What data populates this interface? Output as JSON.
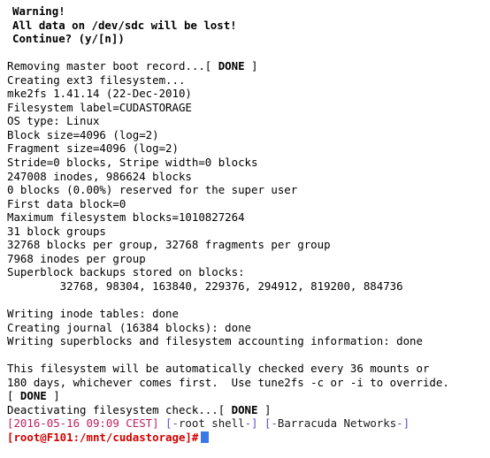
{
  "terminal": {
    "window_title": "mke2fs terminal output",
    "background_color": "#ffffff",
    "foreground_color": "#000000",
    "warning_block": [
      "Warning!",
      "All data on /dev/sdc will be lost!",
      "Continue? (y/[n])"
    ],
    "lines": [
      {
        "id": "removing-mbr",
        "pre": "Removing master boot record...[ ",
        "bold": "DONE",
        "post": " ]"
      },
      {
        "id": "creating-ext3",
        "text": "Creating ext3 filesystem..."
      },
      {
        "id": "mke2fs-version",
        "text": "mke2fs 1.41.14 (22-Dec-2010)"
      },
      {
        "id": "fs-label",
        "text": "Filesystem label=CUDASTORAGE"
      },
      {
        "id": "os-type",
        "text": "OS type: Linux"
      },
      {
        "id": "block-size",
        "text": "Block size=4096 (log=2)"
      },
      {
        "id": "fragment-size",
        "text": "Fragment size=4096 (log=2)"
      },
      {
        "id": "stride-stripe",
        "text": "Stride=0 blocks, Stripe width=0 blocks"
      },
      {
        "id": "inodes-blocks",
        "text": "247008 inodes, 986624 blocks"
      },
      {
        "id": "reserved-blocks",
        "text": "0 blocks (0.00%) reserved for the super user"
      },
      {
        "id": "first-data-block",
        "text": "First data block=0"
      },
      {
        "id": "max-fs-blocks",
        "text": "Maximum filesystem blocks=1010827264"
      },
      {
        "id": "block-groups",
        "text": "31 block groups"
      },
      {
        "id": "blocks-per-group",
        "text": "32768 blocks per group, 32768 fragments per group"
      },
      {
        "id": "inodes-per-group",
        "text": "7968 inodes per group"
      },
      {
        "id": "superblock-header",
        "text": "Superblock backups stored on blocks:"
      },
      {
        "id": "superblock-list",
        "text": "        32768, 98304, 163840, 229376, 294912, 819200, 884736"
      },
      {
        "id": "blank-1",
        "text": ""
      },
      {
        "id": "writing-inode-tables",
        "text": "Writing inode tables: done"
      },
      {
        "id": "creating-journal",
        "text": "Creating journal (16384 blocks): done"
      },
      {
        "id": "writing-superblocks",
        "text": "Writing superblocks and filesystem accounting information: done"
      },
      {
        "id": "blank-2",
        "text": ""
      },
      {
        "id": "autocheck-1",
        "text": "This filesystem will be automatically checked every 36 mounts or"
      },
      {
        "id": "autocheck-2",
        "text": "180 days, whichever comes first.  Use tune2fs -c or -i to override."
      },
      {
        "id": "done-standalone",
        "pre": "[ ",
        "bold": "DONE",
        "post": " ]"
      },
      {
        "id": "deactivating-check",
        "pre": "Deactivating filesystem check...[ ",
        "bold": "DONE",
        "post": " ]"
      }
    ],
    "status_line": {
      "timestamp": "[2016-05-16 09:09 CEST]",
      "shell_open": " [-",
      "shell_label": "root shell",
      "shell_close": "-] ",
      "vendor_open": "[-",
      "vendor_label": "Barracuda Networks",
      "vendor_close": "-]",
      "color": "#c02060",
      "bracket_color": "#5a4fcf"
    },
    "prompt_line": {
      "text": "[root@F101:/mnt/cudastorage]#",
      "color": "#d40000",
      "cursor_color": "#3b78e7"
    }
  }
}
